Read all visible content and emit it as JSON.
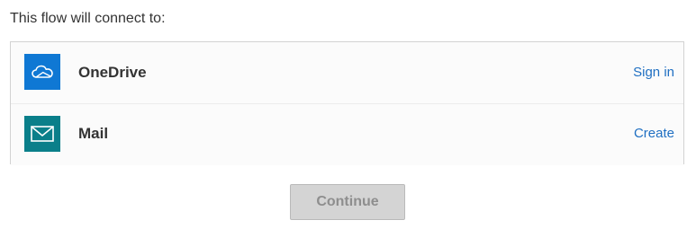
{
  "heading": "This flow will connect to:",
  "connectors": [
    {
      "name": "OneDrive",
      "action": "Sign in",
      "icon": "onedrive-cloud-icon",
      "icon_bg": "#0f78d4"
    },
    {
      "name": "Mail",
      "action": "Create",
      "icon": "mail-envelope-icon",
      "icon_bg": "#0a7f8a"
    }
  ],
  "continue_label": "Continue",
  "colors": {
    "link": "#1f6fc2",
    "button_disabled_bg": "#d4d4d4",
    "button_disabled_text": "#8e8e8e"
  }
}
